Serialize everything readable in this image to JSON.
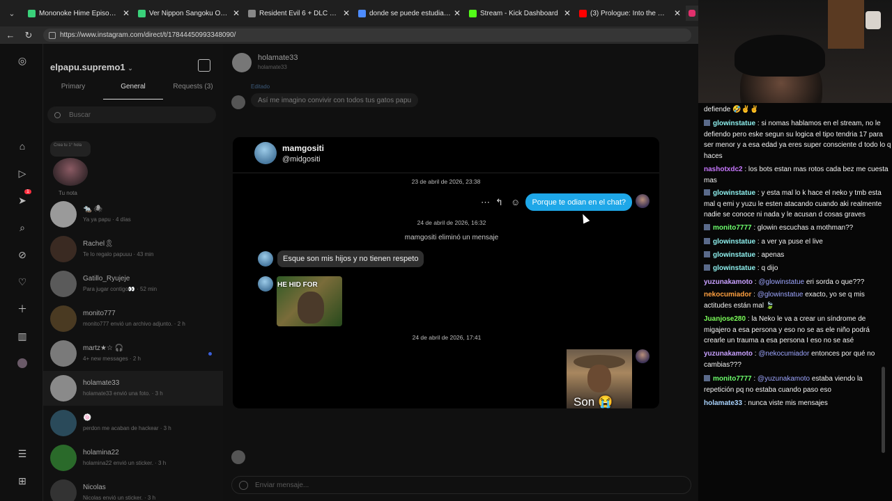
{
  "browser": {
    "tabs": [
      {
        "label": "Mononoke Hime Episodio 1 Sub E",
        "icon": "tv-icon",
        "color": "#3ad17a"
      },
      {
        "label": "Ver Nippon Sangoku Online Sub E",
        "icon": "tv-icon",
        "color": "#3ad17a"
      },
      {
        "label": "Resident Evil 6 + DLC + TU – Legi",
        "icon": "globe-icon",
        "color": "#888888"
      },
      {
        "label": "donde se puede estudiar derecho",
        "icon": "search-icon",
        "color": "#4d8cff"
      },
      {
        "label": "Stream - Kick Dashboard",
        "icon": "kick-icon",
        "color": "#53fc18"
      },
      {
        "label": "(3) Prologue: Into the Woods (Fro",
        "icon": "youtube-icon",
        "color": "#ff0000"
      }
    ],
    "url": "https://www.instagram.com/direct/t/17844450993348090/"
  },
  "sidebar": {
    "account": "elpapu.supremo1",
    "tabs": [
      "Primary",
      "General",
      "Requests (3)"
    ],
    "search_placeholder": "Buscar",
    "note_text": "Crea tu 1° hola",
    "note_label": "Tu nota",
    "badge": "1",
    "conversations": [
      {
        "name": "🐀 🕷",
        "preview": "Ya ya papu · 4 días"
      },
      {
        "name": "Rachel🎗",
        "preview": "Te lo regalo papuuu · 43 min"
      },
      {
        "name": "Gatillo_Ryujeje",
        "preview": "Para jugar contigo👀 · 52 min"
      },
      {
        "name": "monito777",
        "preview": "monito777 envió un archivo adjunto. · 2 h"
      },
      {
        "name": "martz★☆ 🎧",
        "preview": "4+ new messages · 2 h"
      },
      {
        "name": "holamate33",
        "preview": "holamate33 envió una foto. · 3 h"
      },
      {
        "name": "🍥",
        "preview": "perdon me acaban de hackear · 3 h"
      },
      {
        "name": "holamina22",
        "preview": "holamina22 envió un sticker. · 3 h"
      },
      {
        "name": "Nicolas",
        "preview": "Nicolas envió un sticker. · 3 h"
      }
    ]
  },
  "thread": {
    "name": "holamate33",
    "handle": "holamate33",
    "edited_label": "Editado",
    "old_message": "Así me imagino convivir con todos tus gatos papu",
    "input_placeholder": "Enviar mensaje..."
  },
  "popup": {
    "name": "mamgositi",
    "handle": "@midgositi",
    "timestamp1": "23 de abril de 2026, 23:38",
    "sent_message": "Porque te odian en el chat?",
    "timestamp2": "24 de abril de 2026, 16:32",
    "system_message": "mamgositi eliminó un mensaje",
    "received_message": "Esque son mis hijos y no tienen respeto",
    "meme_caption": "HE HID FOR",
    "timestamp3": "24 de abril de 2026, 17:41",
    "photo_caption": "Son 😭"
  },
  "chat": {
    "lines": [
      {
        "user": "",
        "color": "#ffffff",
        "text": "defiende 🤣✌✌",
        "mentions": [],
        "badge": false
      },
      {
        "user": "glowinstatue",
        "color": "#8ef0ee",
        "text": "si nomas hablamos en el stream, no le defiendo pero eske segun su logica el tipo tendria 17 para ser menor y a esa edad ya eres super consciente d todo lo q haces",
        "badge": true
      },
      {
        "user": "nashotxdc2",
        "color": "#c878ff",
        "text": "los bots estan mas rotos cada bez me cuesta mas",
        "badge": false
      },
      {
        "user": "glowinstatue",
        "color": "#8ef0ee",
        "text": "y esta mal lo k hace el neko y tmb esta mal q emi y yuzu le esten atacando cuando aki realmente nadie se conoce ni nada y le acusan d cosas graves",
        "badge": true
      },
      {
        "user": "monito7777",
        "color": "#6cff6c",
        "text": "glowin escuchas a mothman??",
        "badge": true
      },
      {
        "user": "glowinstatue",
        "color": "#8ef0ee",
        "text": "a ver ya puse el live",
        "badge": true
      },
      {
        "user": "glowinstatue",
        "color": "#8ef0ee",
        "text": "apenas",
        "badge": true
      },
      {
        "user": "glowinstatue",
        "color": "#8ef0ee",
        "text": "q dijo",
        "badge": true
      },
      {
        "user": "yuzunakamoto",
        "color": "#c8a0ff",
        "mention": "@glowinstatue",
        "text": "eri sorda o que???",
        "badge": false
      },
      {
        "user": "nekocumiador",
        "color": "#ffa040",
        "mention": "@glowinstatue",
        "text": "exacto, yo se q mis actitudes están mal 🍃",
        "badge": false
      },
      {
        "user": "Juanjose280",
        "color": "#7cff5a",
        "text": "la Neko le va a crear un síndrome de migajero a esa persona y eso no se as ele niño podrá crearle un trauma a esa persona I eso no se asé",
        "badge": false
      },
      {
        "user": "yuzunakamoto",
        "color": "#c8a0ff",
        "mention": "@nekocumiador",
        "text": "entonces por qué no cambias???",
        "badge": false
      },
      {
        "user": "monito7777",
        "color": "#6cff6c",
        "mention": "@yuzunakamoto",
        "text": "estaba viendo la repetición pq no estaba cuando paso eso",
        "badge": true
      },
      {
        "user": "holamate33",
        "color": "#aad4ff",
        "text": "nunca viste mis mensajes",
        "badge": false
      }
    ]
  }
}
